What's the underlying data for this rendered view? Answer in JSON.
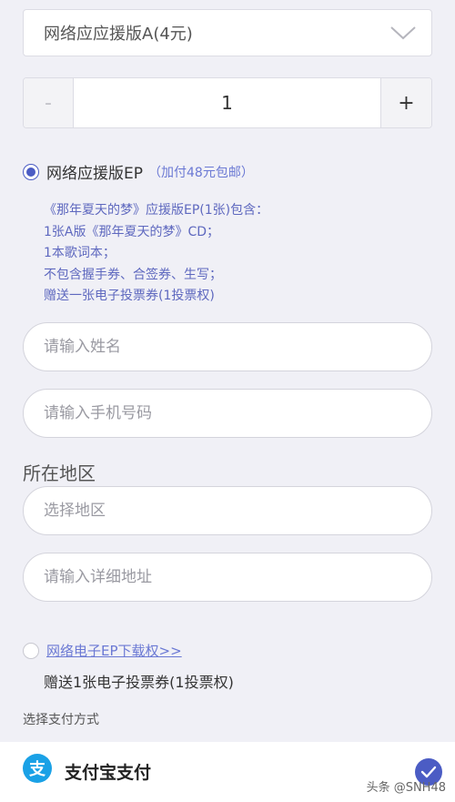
{
  "version_select": {
    "value": "网络应应援版A(4元)"
  },
  "quantity": {
    "minus_label": "-",
    "value": "1",
    "plus_label": "+"
  },
  "option_ep": {
    "label": "网络应援版EP",
    "note": "（加付48元包邮）",
    "selected": true,
    "description": [
      "《那年夏天的梦》应援版EP(1张)包含：",
      "1张A版《那年夏天的梦》CD；",
      "1本歌词本；",
      "不包含握手券、合签券、生写；",
      "赠送一张电子投票券(1投票权)"
    ]
  },
  "form": {
    "name_placeholder": "请输入姓名",
    "phone_placeholder": "请输入手机号码",
    "region_label": "所在地区",
    "region_placeholder": "选择地区",
    "address_placeholder": "请输入详细地址"
  },
  "option_download": {
    "link": "网络电子EP下载权>>",
    "sub": "赠送1张电子投票券(1投票权)",
    "selected": false
  },
  "payment": {
    "section_title": "选择支付方式",
    "alipay_icon_glyph": "支",
    "alipay_label": "支付宝支付",
    "selected": true
  },
  "watermark": "头条 @SNH48",
  "colors": {
    "accent": "#4b5cc4",
    "link": "#6b79d4",
    "alipay": "#1aa1e6"
  }
}
